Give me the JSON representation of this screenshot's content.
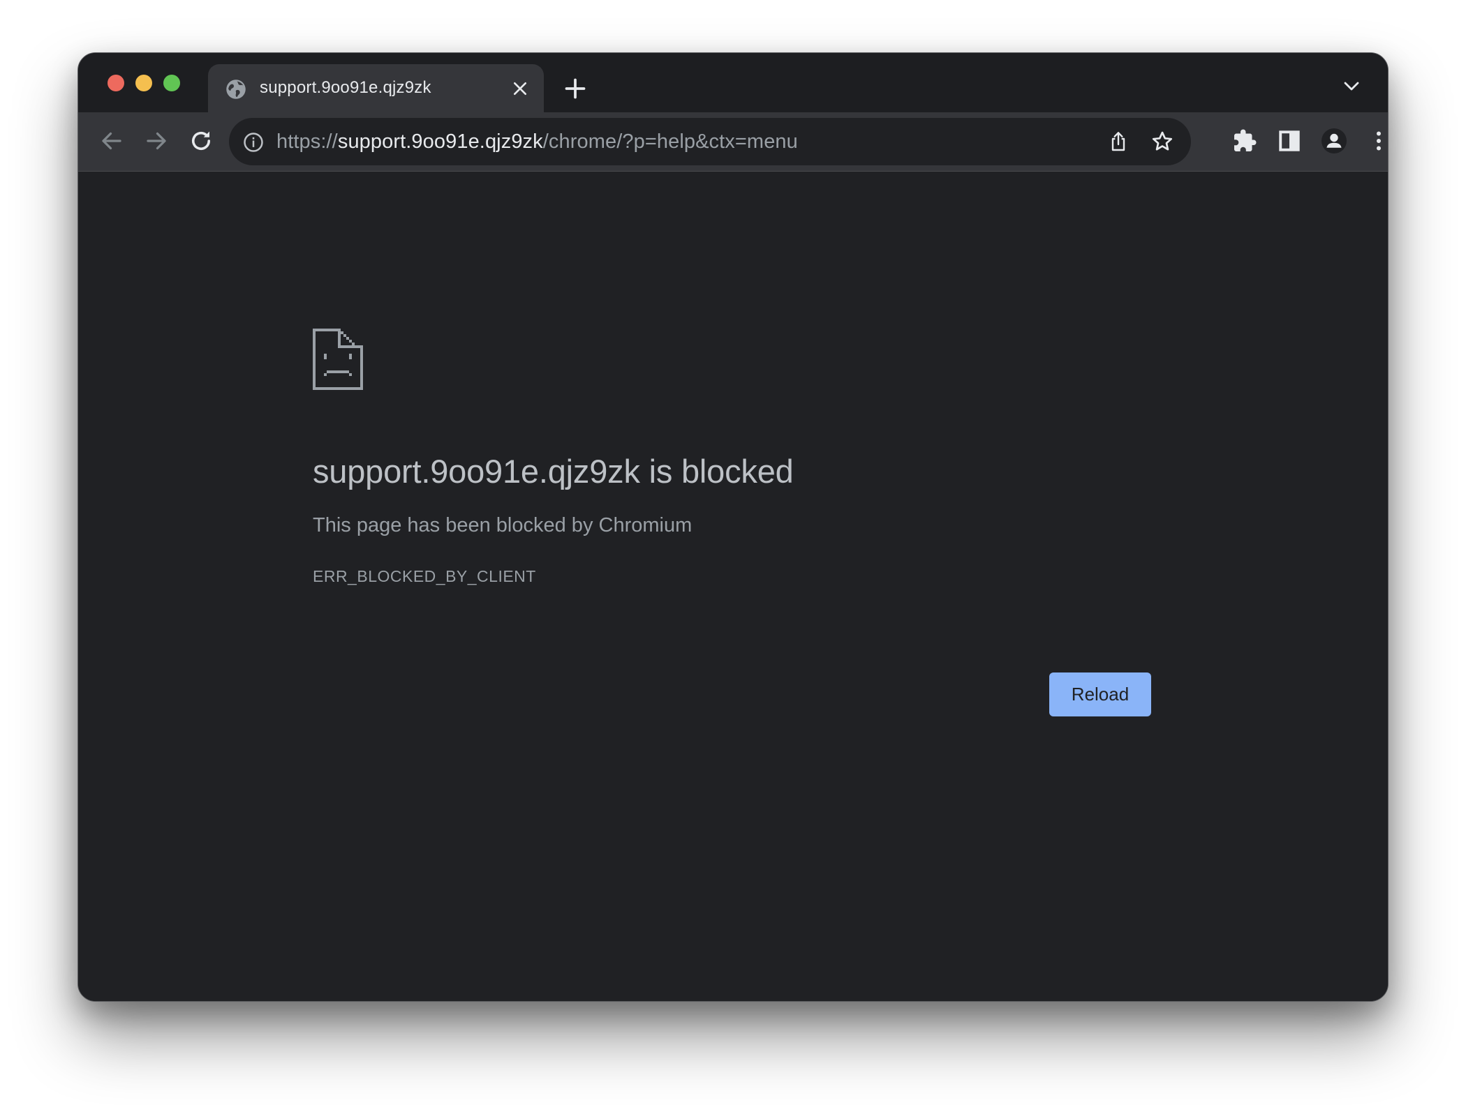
{
  "window": {
    "traffic_lights": {
      "red": "#ed6a5e",
      "yellow": "#f5bf4f",
      "green": "#61c554"
    }
  },
  "tab": {
    "title": "support.9oo91e.qjz9zk",
    "favicon": "globe-icon",
    "close_icon": "close-icon"
  },
  "tabstrip": {
    "new_tab_icon": "plus-icon",
    "tab_search_icon": "chevron-down-icon"
  },
  "toolbar": {
    "back_icon": "arrow-left-icon",
    "forward_icon": "arrow-right-icon",
    "reload_icon": "reload-icon",
    "extensions_icon": "puzzle-icon",
    "side_panel_icon": "side-panel-icon",
    "profile_icon": "profile-icon",
    "menu_icon": "kebab-icon"
  },
  "omnibox": {
    "scheme": "https://",
    "host": "support.9oo91e.qjz9zk",
    "path": "/chrome/?p=help&ctx=menu",
    "info_icon": "info-icon",
    "share_icon": "share-icon",
    "bookmark_icon": "star-icon"
  },
  "error_page": {
    "icon": "sad-page-icon",
    "title": "support.9oo91e.qjz9zk is blocked",
    "subtitle": "This page has been blocked by Chromium",
    "code": "ERR_BLOCKED_BY_CLIENT",
    "reload_label": "Reload"
  },
  "colors": {
    "page_bg": "#202124",
    "toolbar_bg": "#35363a",
    "accent": "#8ab4f8",
    "text_primary": "#bdc1c6",
    "text_secondary": "#9aa0a6"
  }
}
